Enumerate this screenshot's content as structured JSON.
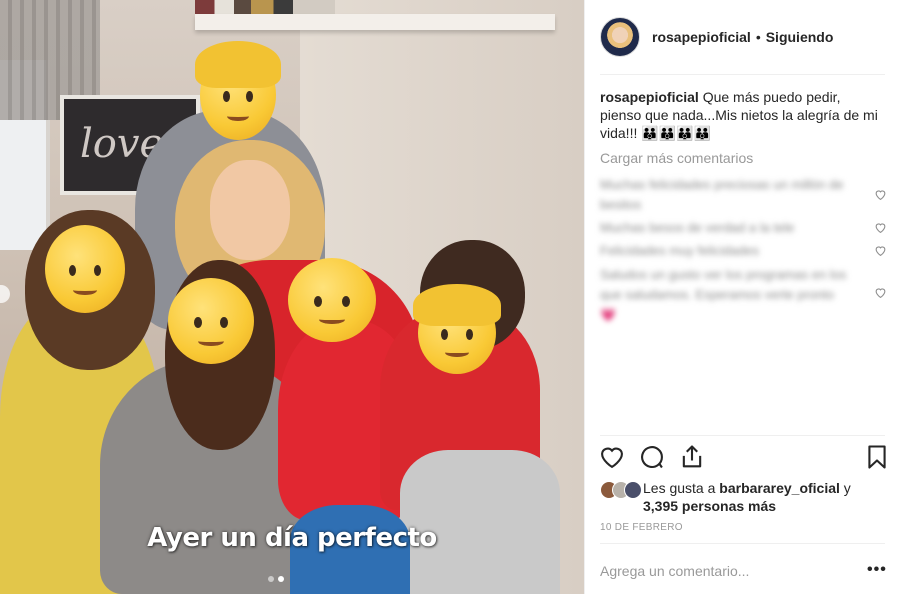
{
  "photo": {
    "overlay_caption": "Ayer un día perfecto",
    "board_text": "love",
    "carousel": {
      "count": 2,
      "active": 2
    }
  },
  "header": {
    "username": "rosapepioficial",
    "separator": "•",
    "follow_status": "Siguiendo"
  },
  "caption": {
    "username": "rosapepioficial",
    "text": "Que más puedo pedir, pienso que nada...Mis nietos la alegría de mi vida!!! 👪👪👪👪"
  },
  "load_more": "Cargar más comentarios",
  "comments": [
    {
      "text": "Muchas felicidades preciosas un millón de besitos"
    },
    {
      "text": "Muchas besos de verdad a la tele"
    },
    {
      "text": "Felicidades muy felicidades"
    },
    {
      "text": "Saludos un gusto ver los programas en los que saludamos. Esperamos verte pronto 💗"
    }
  ],
  "actions": {
    "like": "heart-icon",
    "comment": "comment-icon",
    "share": "share-icon",
    "save": "bookmark-icon"
  },
  "likes": {
    "prefix": "Les gusta a",
    "user": "barbararey_oficial",
    "connector": "y",
    "count": "3,395 personas más"
  },
  "date": "10 DE FEBRERO",
  "add_comment_placeholder": "Agrega un comentario...",
  "more_options": "•••"
}
